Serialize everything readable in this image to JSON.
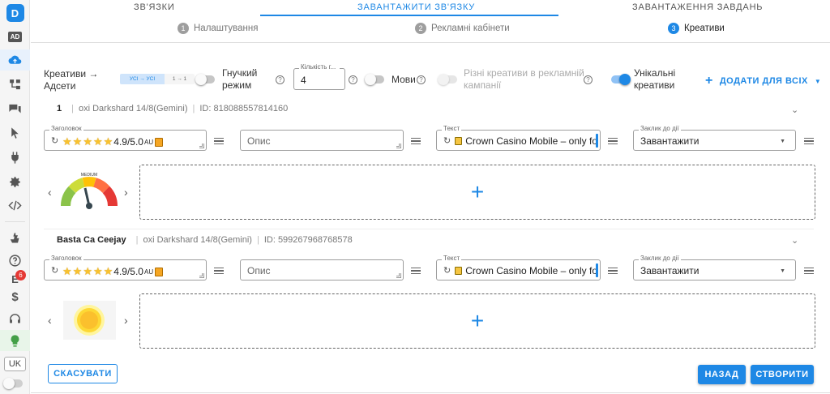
{
  "sidebar": {
    "logo": "D",
    "ad_label": "AD",
    "notification_count": "6",
    "lang": "UK"
  },
  "tabs": [
    {
      "label": "ЗВ'ЯЗКИ"
    },
    {
      "label": "ЗАВАНТАЖИТИ ЗВ'ЯЗКУ"
    },
    {
      "label": "ЗАВАНТАЖЕННЯ ЗАВДАНЬ"
    }
  ],
  "steps": [
    {
      "num": "1",
      "label": "Налаштування"
    },
    {
      "num": "2",
      "label": "Рекламні кабінети"
    },
    {
      "num": "3",
      "label": "Креативи"
    }
  ],
  "options": {
    "mapping_label_line1": "Креативи →",
    "mapping_label_line2": "Адсети",
    "mapping_chip_all": "УСІ → УСІ",
    "mapping_chip_one": "1 → 1",
    "flexible_line1": "Гнучкий",
    "flexible_line2": "режим",
    "count_label": "Кількість г...",
    "count_value": "4",
    "languages": "Мови",
    "different_line1": "Різні креативи в рекламній",
    "different_line2": "кампанії",
    "unique_line1": "Унікальні",
    "unique_line2": "креативи",
    "add_all": "ДОДАТИ ДЛЯ ВСІХ",
    "help_glyph": "?"
  },
  "ads": [
    {
      "number": "1",
      "account": "oxi Darkshard 14/8(Gemini)",
      "id": "ID: 818088557814160",
      "title_label": "Заголовок",
      "title_rating": "4.9/5.0",
      "title_suffix": "AU",
      "description_placeholder": "Опис",
      "text_label": "Текст",
      "text_value": "Crown Casino Mobile – only fo",
      "cta_label": "Заклик до дії",
      "cta_value": "Завантажити",
      "gauge_label": "MEDIUM"
    },
    {
      "number": "Basta Ca Ceejay",
      "account": "oxi Darkshard 14/8(Gemini)",
      "id": "ID: 599267968768578",
      "title_label": "Заголовок",
      "title_rating": "4.9/5.0",
      "title_suffix": "AU",
      "description_placeholder": "Опис",
      "text_label": "Текст",
      "text_value": "Crown Casino Mobile – only fo",
      "cta_label": "Заклик до дії",
      "cta_value": "Завантажити"
    }
  ],
  "footer": {
    "cancel": "СКАСУВАТИ",
    "back": "НАЗАД",
    "create": "СТВОРИТИ"
  },
  "colors": {
    "accent": "#1e88e5",
    "star": "#f9c22e",
    "badge": "#e53935"
  }
}
